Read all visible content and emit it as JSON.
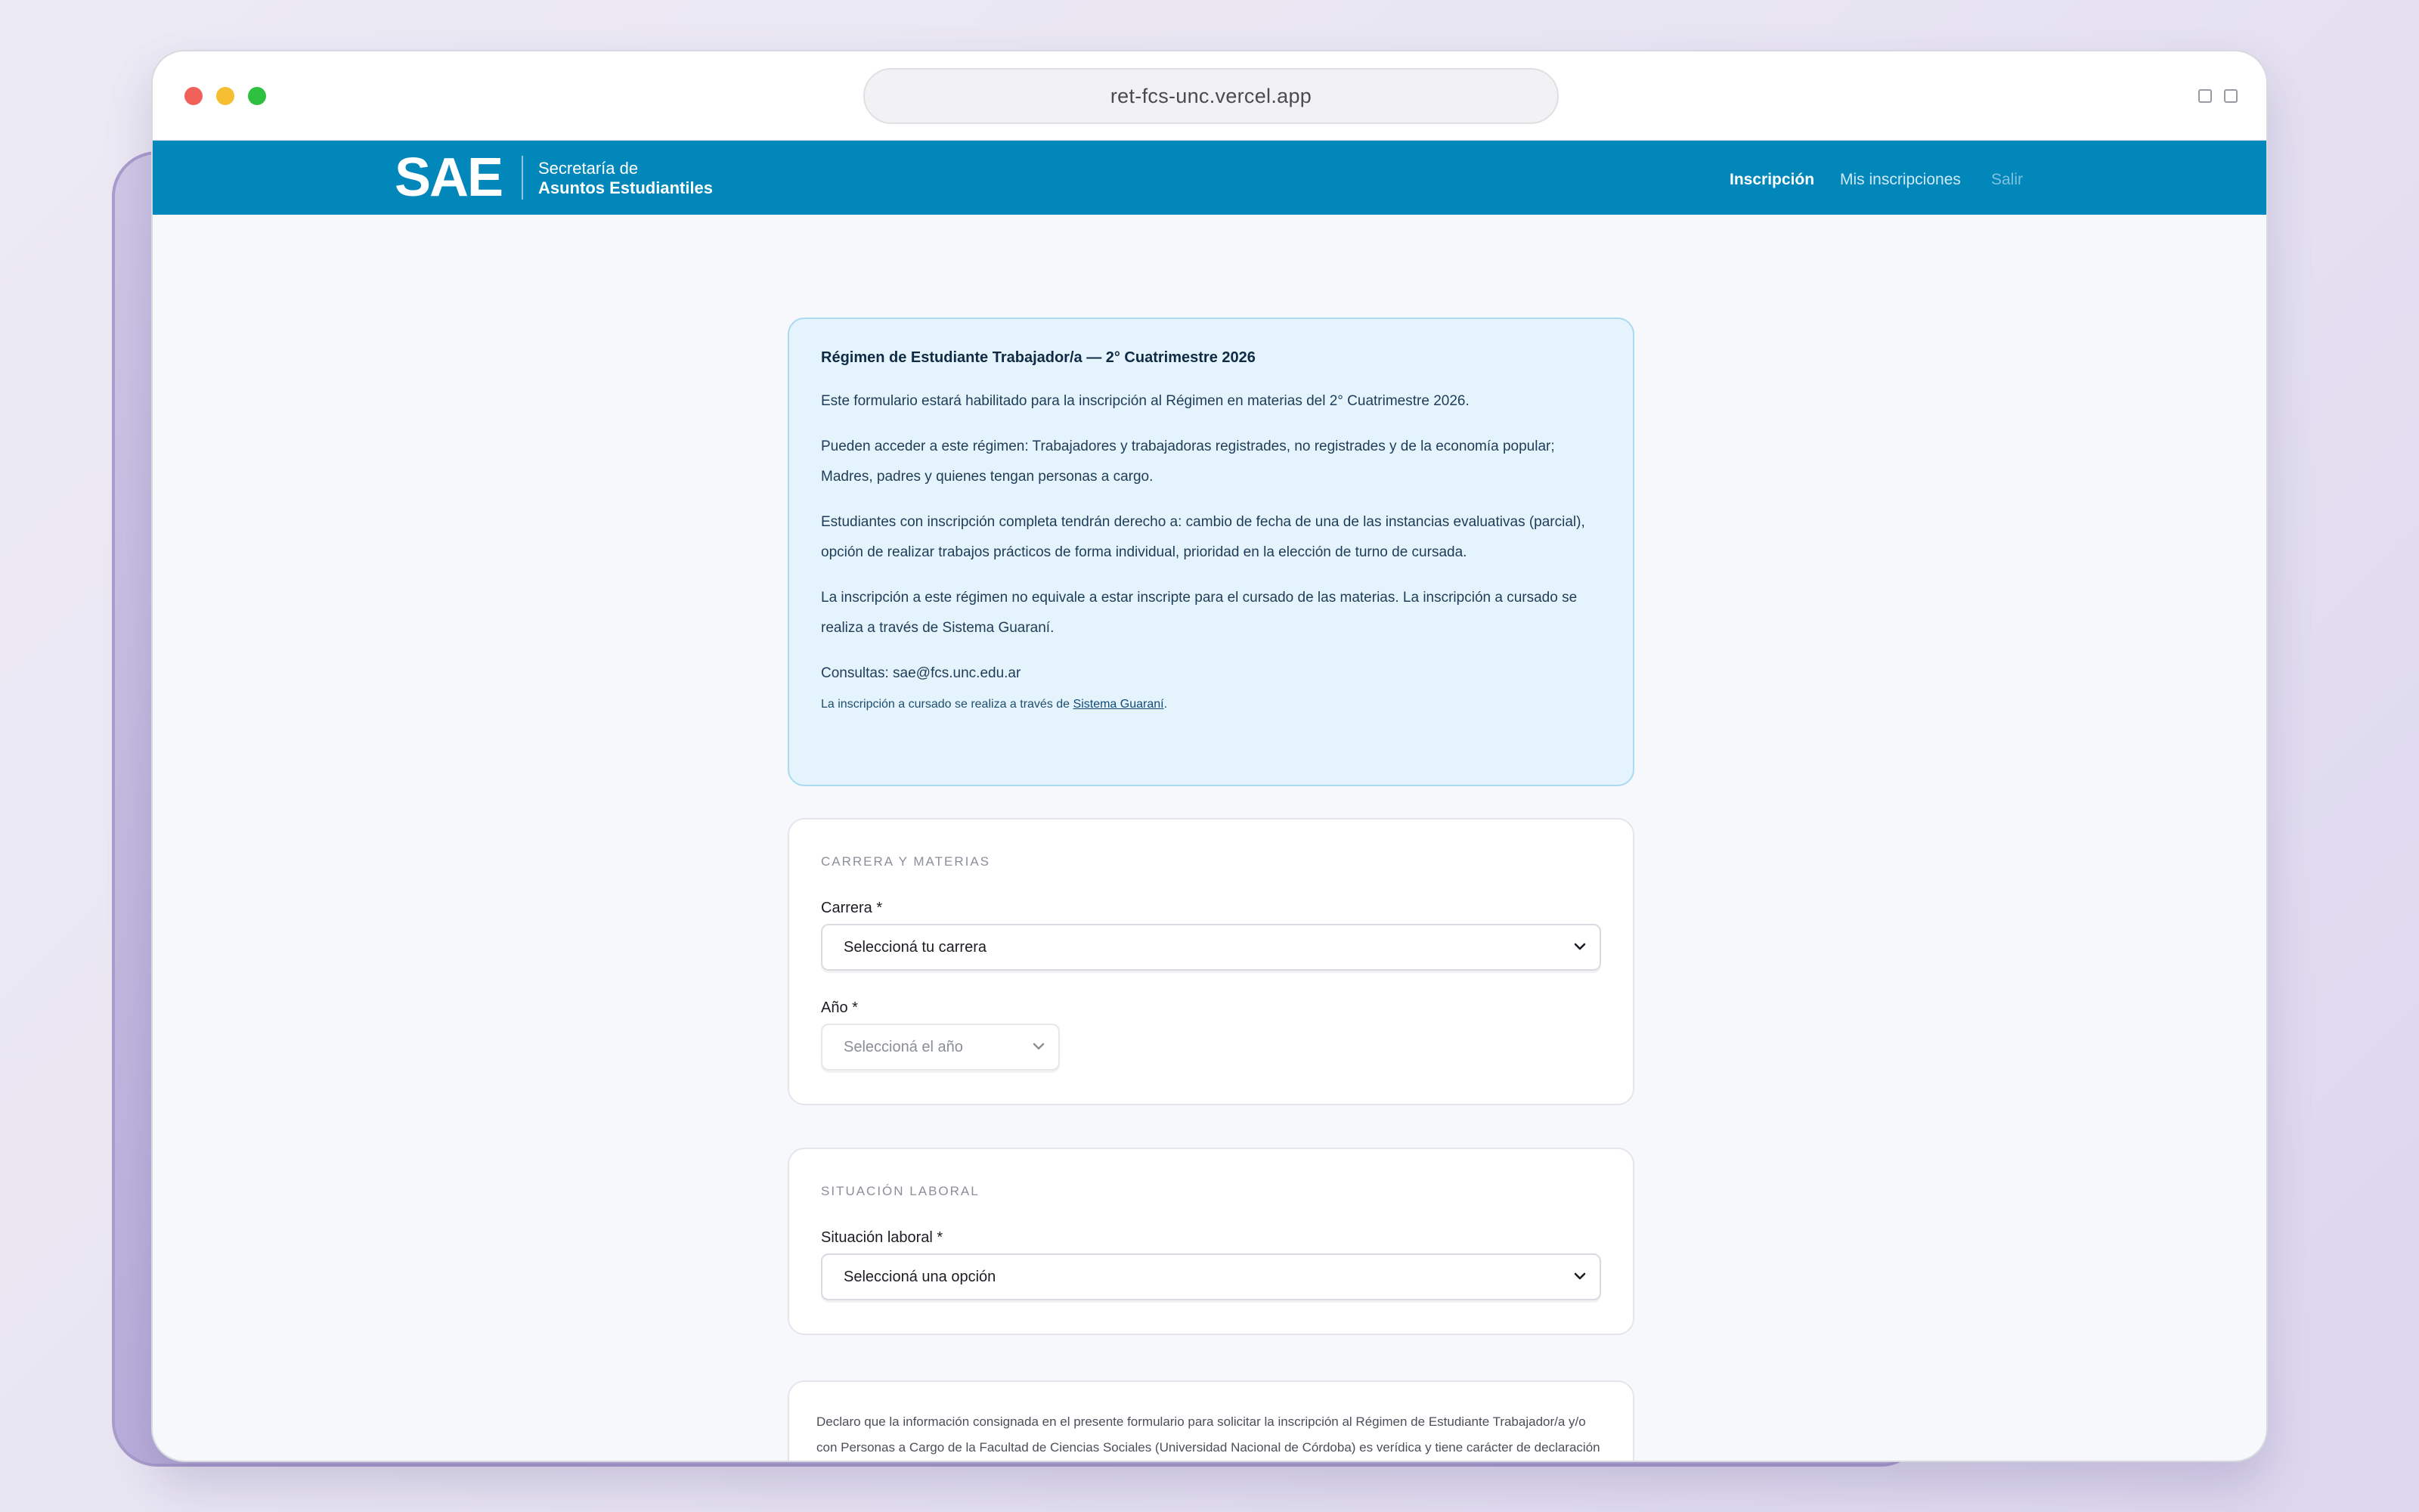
{
  "browser": {
    "url": "ret-fcs-unc.vercel.app"
  },
  "header": {
    "logo_text": "SAE",
    "logo_sub_line1": "Secretaría de",
    "logo_sub_line2": "Asuntos Estudiantiles",
    "nav": [
      {
        "label": "Inscripción",
        "state": "active"
      },
      {
        "label": "Mis inscripciones",
        "state": "normal"
      },
      {
        "label": "Salir",
        "state": "dim"
      }
    ]
  },
  "info": {
    "title": "Régimen de Estudiante Trabajador/a — 2° Cuatrimestre 2026",
    "paragraphs": [
      "Este formulario estará habilitado para la inscripción al Régimen en materias del 2° Cuatrimestre 2026.",
      "Pueden acceder a este régimen: Trabajadores y trabajadoras registrades, no registrades y de la economía popular; Madres, padres y quienes tengan personas a cargo.",
      "Estudiantes con inscripción completa tendrán derecho a: cambio de fecha de una de las instancias evaluativas (parcial), opción de realizar trabajos prácticos de forma individual, prioridad en la elección de turno de cursada.",
      "La inscripción a este régimen no equivale a estar inscripte para el cursado de las materias. La inscripción a cursado se realiza a través de Sistema Guaraní.",
      "Consultas: sae@fcs.unc.edu.ar"
    ],
    "footnote_prefix": "La inscripción a cursado se realiza a través de ",
    "footnote_link": "Sistema Guaraní",
    "footnote_suffix": "."
  },
  "carrera_section": {
    "title": "CARRERA Y MATERIAS",
    "carrera_label": "Carrera *",
    "carrera_value": "Seleccioná tu carrera",
    "anio_label": "Año *",
    "anio_value": "Seleccioná el año"
  },
  "laboral_section": {
    "title": "SITUACIÓN LABORAL",
    "label": "Situación laboral *",
    "value": "Seleccioná una opción"
  },
  "declaration": {
    "text": "Declaro que la información consignada en el presente formulario para solicitar la inscripción al Régimen de Estudiante Trabajador/a y/o con Personas a Cargo de la Facultad de Ciencias Sociales (Universidad Nacional de Córdoba) es verídica y tiene carácter de declaración jurada. Asimismo, tomo conocimiento de que la SAE podrá solicitar documentación respaldatoria y/o verificar los datos proporcionados."
  }
}
